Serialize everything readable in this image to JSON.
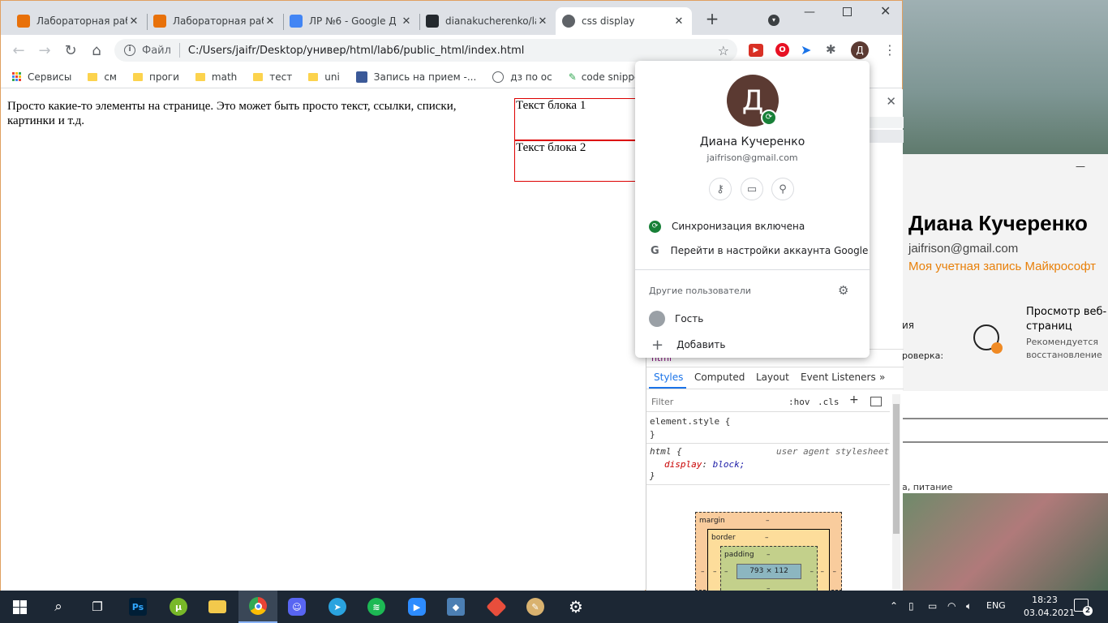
{
  "tabs": [
    {
      "title": "Лабораторная раб",
      "color": "#e8710a",
      "active": false
    },
    {
      "title": "Лабораторная раб",
      "color": "#e8710a",
      "active": false
    },
    {
      "title": "ЛР №6 - Google Д",
      "color": "#4285f4",
      "active": false
    },
    {
      "title": "dianakucherenko/la",
      "color": "#24292e",
      "active": false
    },
    {
      "title": "css display",
      "color": "#5f6368",
      "active": true
    }
  ],
  "toolbar": {
    "file_label": "Файл",
    "url": "C:/Users/jaifr/Desktop/универ/html/lab6/public_html/index.html",
    "profile_letter": "Д"
  },
  "bookmarks": [
    "Сервисы",
    "см",
    "проги",
    "math",
    "тест",
    "uni",
    "Запись на прием -...",
    "дз по ос",
    "code snippets"
  ],
  "page": {
    "paragraph": "Просто какие-то элементы на странице. Это может быть просто текст, ссылки, списки, картинки и т.д.",
    "block1": "Текст блока 1",
    "block2": "Текст блока 2"
  },
  "devtools": {
    "breadcrumb": "html",
    "tabs": [
      "Styles",
      "Computed",
      "Layout",
      "Event Listeners"
    ],
    "filter_placeholder": "Filter",
    "hov": ":hov",
    "cls": ".cls",
    "element_style": "element.style {",
    "close_brace": "}",
    "rule_selector": "html {",
    "rule_source": "user agent stylesheet",
    "rule_prop": "display",
    "rule_value": "block;",
    "box": {
      "margin": "margin",
      "border": "border",
      "padding": "padding",
      "dash": "–",
      "size": "793 × 112"
    }
  },
  "popup": {
    "avatar": "Д",
    "name": "Диана Кучеренко",
    "email": "jaifrison@gmail.com",
    "sync": "Синхронизация включена",
    "manage": "Перейти в настройки аккаунта Google",
    "others": "Другие пользователи",
    "guest": "Гость",
    "add": "Добавить"
  },
  "settings": {
    "name": "Диана Кучеренко",
    "email": "jaifrison@gmail.com",
    "ms_account": "Моя учетная запись Майкрософт",
    "item_title": "Просмотр веб-страниц",
    "item_sub": "Рекомендуется восстановление",
    "left_frag1": "ия",
    "left_frag2": "роверка:",
    "bottom_frag": "а, питание"
  },
  "taskbar": {
    "lang": "ENG",
    "time": "18:23",
    "date": "03.04.2021",
    "notif": "2"
  }
}
